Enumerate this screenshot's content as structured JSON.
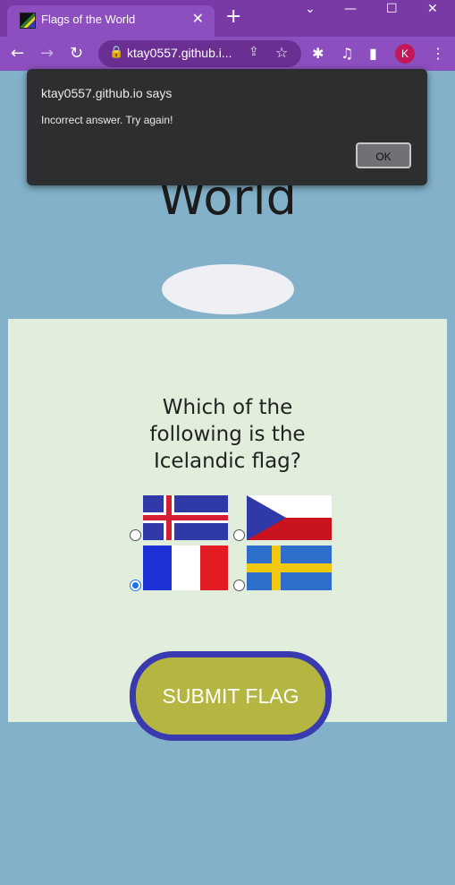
{
  "browser": {
    "tab_title": "Flags of the World",
    "url": "ktay0557.github.i...",
    "avatar_letter": "K",
    "accent": "#7a3aa6"
  },
  "page": {
    "heading": "World",
    "question_lines": [
      "Which of the",
      "following is the",
      "Icelandic flag?"
    ],
    "options": [
      {
        "name": "Iceland",
        "selected": false
      },
      {
        "name": "Czech Republic",
        "selected": false
      },
      {
        "name": "France",
        "selected": true
      },
      {
        "name": "Sweden",
        "selected": false
      }
    ],
    "submit_label": "SUBMIT FLAG"
  },
  "dialog": {
    "title": "ktay0557.github.io says",
    "message": "Incorrect answer. Try again!",
    "ok_label": "OK"
  }
}
